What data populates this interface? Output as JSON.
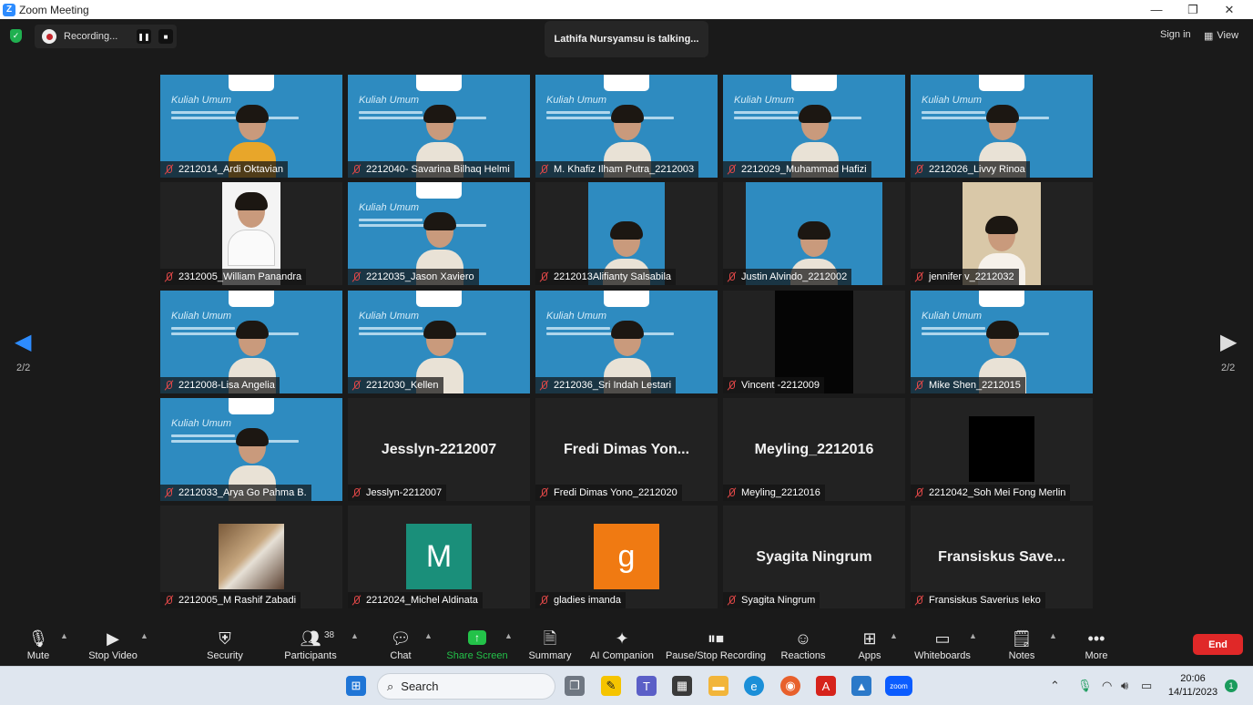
{
  "window": {
    "title": "Zoom Meeting",
    "minimize": "—",
    "restore": "❐",
    "close": "✕"
  },
  "top": {
    "recording_label": "Recording...",
    "talking": "Lathifa Nursyamsu is talking...",
    "sign_in": "Sign in",
    "view": "View"
  },
  "pager": {
    "left": "2/2",
    "right": "2/2"
  },
  "tiles": [
    {
      "name": "2212014_Ardi Oktavian",
      "type": "slide"
    },
    {
      "name": "2212040- Savarina Bilhaq Helmi",
      "type": "slide"
    },
    {
      "name": "M. Khafiz Ilham Putra_2212003",
      "type": "slide"
    },
    {
      "name": "2212029_Muhammad Hafizi",
      "type": "slide"
    },
    {
      "name": "2212026_Livvy Rinoa",
      "type": "slide"
    },
    {
      "name": "2312005_William Panandra",
      "type": "portrait"
    },
    {
      "name": "2212035_Jason Xaviero",
      "type": "slide"
    },
    {
      "name": "2212013Alifianty Salsabila",
      "type": "narrowslide"
    },
    {
      "name": "Justin Alvindo_2212002",
      "type": "narrowslide"
    },
    {
      "name": "jennifer v_2212032",
      "type": "room"
    },
    {
      "name": "2212008-Lisa Angelia",
      "type": "slide"
    },
    {
      "name": "2212030_Kellen",
      "type": "slide"
    },
    {
      "name": "2212036_Sri Indah Lestari",
      "type": "slide"
    },
    {
      "name": "Vincent -2212009",
      "type": "dark"
    },
    {
      "name": "Mike Shen_2212015",
      "type": "slide"
    },
    {
      "name": "2212033_Arya Go Pahma B.",
      "type": "slide"
    },
    {
      "name": "Jesslyn-2212007",
      "type": "text",
      "big": "Jesslyn-2212007"
    },
    {
      "name": "Fredi Dimas Yono_2212020",
      "type": "text",
      "big": "Fredi Dimas Yon..."
    },
    {
      "name": "Meyling_2212016",
      "type": "text",
      "big": "Meyling_2212016"
    },
    {
      "name": "2212042_Soh Mei Fong Merlin",
      "type": "blackbox"
    },
    {
      "name": "2212005_M Rashif Zabadi",
      "type": "photo"
    },
    {
      "name": "2212024_Michel Aldinata",
      "type": "avatar",
      "letter": "M",
      "color": "#1a8f7a"
    },
    {
      "name": "gladies imanda",
      "type": "avatar",
      "letter": "g",
      "color": "#f07a12"
    },
    {
      "name": "Syagita Ningrum",
      "type": "text",
      "big": "Syagita Ningrum"
    },
    {
      "name": "Fransiskus Saverius Ieko",
      "type": "text",
      "big": "Fransiskus Save..."
    }
  ],
  "slide": {
    "heading": "Kuliah Umum"
  },
  "toolbar": {
    "mute": "Mute",
    "stop_video": "Stop Video",
    "security": "Security",
    "participants": "Participants",
    "participant_count": "38",
    "chat": "Chat",
    "share_screen": "Share Screen",
    "summary": "Summary",
    "ai_companion": "AI Companion",
    "pause_stop_recording": "Pause/Stop Recording",
    "reactions": "Reactions",
    "apps": "Apps",
    "whiteboards": "Whiteboards",
    "notes": "Notes",
    "more": "More",
    "end": "End"
  },
  "taskbar": {
    "search": "Search",
    "time": "20:06",
    "date": "14/11/2023",
    "notifications": "1",
    "zoom_label": "zoom"
  },
  "colors": {
    "slide_blue": "#2e8bc0",
    "end_red": "#e02828",
    "share_green": "#23c249",
    "accent_blue": "#2d8cff"
  }
}
